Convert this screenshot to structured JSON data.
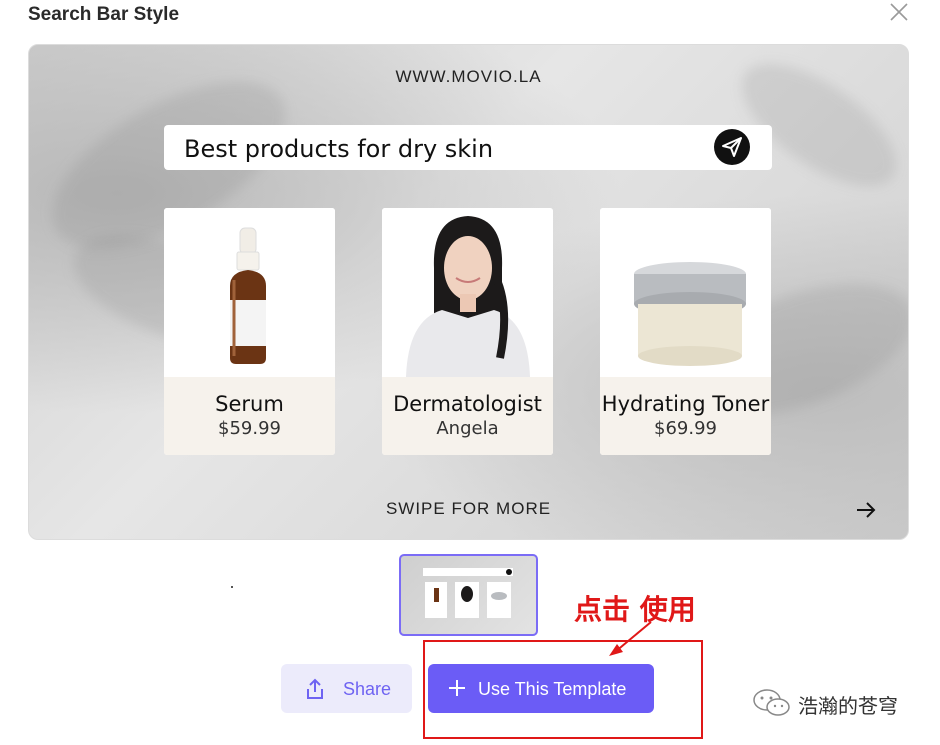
{
  "modal": {
    "title": "Search Bar Style"
  },
  "preview": {
    "site": "WWW.MOVIO.LA",
    "search_text": "Best products for dry skin",
    "cards": [
      {
        "name": "Serum",
        "sub": "$59.99",
        "image": "serum-bottle"
      },
      {
        "name": "Dermatologist",
        "sub": "Angela",
        "image": "avatar-photo"
      },
      {
        "name": "Hydrating Toner",
        "sub": "$69.99",
        "image": "cream-jar"
      }
    ],
    "swipe": "SWIPE FOR MORE"
  },
  "thumbnail": {
    "search_text": "Best products for dry skin",
    "cards": [
      "Serum",
      "Dermatologist",
      "Hydrating Toner"
    ]
  },
  "actions": {
    "share_label": "Share",
    "use_label": "Use This Template"
  },
  "annotation": {
    "text": "点击 使用"
  },
  "watermark": {
    "text": "浩瀚的苍穹"
  },
  "colors": {
    "accent": "#6b5cf6",
    "share_bg": "#ecebfb",
    "annotation": "#e01818"
  }
}
